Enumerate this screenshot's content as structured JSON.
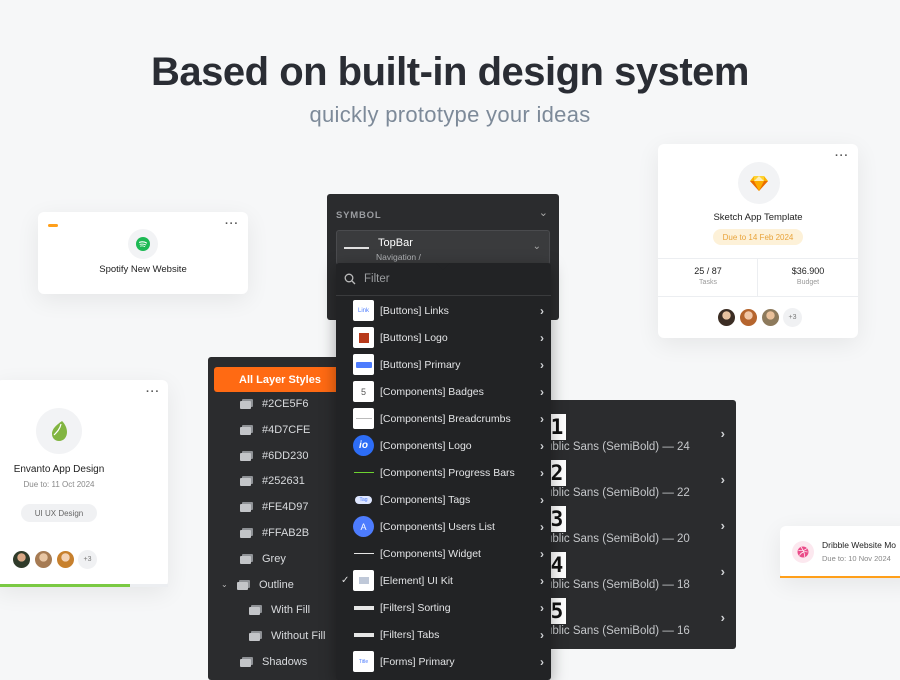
{
  "hero": {
    "title": "Based on built-in design system",
    "subtitle": "quickly prototype your ideas"
  },
  "cards": {
    "spotify": {
      "name": "Spotify New Website",
      "menu": "···"
    },
    "sketch": {
      "name": "Sketch App Template",
      "due": "Due to 14 Feb 2024",
      "tasks_value": "25 / 87",
      "tasks_label": "Tasks",
      "budget_value": "$36.900",
      "budget_label": "Budget",
      "more": "+3",
      "menu": "···"
    },
    "envanto": {
      "name": "Envanto App Design",
      "due": "Due to: 11 Oct 2024",
      "tag": "UI UX Design",
      "more": "+3",
      "progress": 0.78,
      "menu": "···"
    },
    "dribble": {
      "name": "Dribble Website Mo",
      "due": "Due to: 10 Nov 2024"
    }
  },
  "symbol_panel": {
    "title": "SYMBOL",
    "selected_name": "TopBar",
    "selected_path": "Navigation /",
    "filter_placeholder": "Filter",
    "items": [
      {
        "label": "[Buttons] Links",
        "checked": false
      },
      {
        "label": "[Buttons] Logo",
        "checked": false
      },
      {
        "label": "[Buttons] Primary",
        "checked": false
      },
      {
        "label": "[Components] Badges",
        "checked": false
      },
      {
        "label": "[Components] Breadcrumbs",
        "checked": false
      },
      {
        "label": "[Components] Logo",
        "checked": false
      },
      {
        "label": "[Components] Progress Bars",
        "checked": false
      },
      {
        "label": "[Components] Tags",
        "checked": false
      },
      {
        "label": "[Components] Users List",
        "checked": false
      },
      {
        "label": "[Components] Widget",
        "checked": false
      },
      {
        "label": "[Element] UI Kit",
        "checked": true
      },
      {
        "label": "[Filters] Sorting",
        "checked": false
      },
      {
        "label": "[Filters] Tabs",
        "checked": false
      },
      {
        "label": "[Forms] Primary",
        "checked": false
      }
    ],
    "thumbs": {
      "links": "Link",
      "badge": "5",
      "logo_io": "io",
      "tag": "Tag",
      "user": "A",
      "forms": "Title"
    }
  },
  "layer_panel": {
    "header": "All Layer Styles",
    "items": [
      {
        "label": "#2CE5F6",
        "indent": 0,
        "expandable": false
      },
      {
        "label": "#4D7CFE",
        "indent": 0,
        "expandable": false
      },
      {
        "label": "#6DD230",
        "indent": 0,
        "expandable": false
      },
      {
        "label": "#252631",
        "indent": 0,
        "expandable": false
      },
      {
        "label": "#FE4D97",
        "indent": 0,
        "expandable": false
      },
      {
        "label": "#FFAB2B",
        "indent": 0,
        "expandable": false
      },
      {
        "label": "Grey",
        "indent": 0,
        "expandable": false
      },
      {
        "label": "Outline",
        "indent": 0,
        "expandable": true
      },
      {
        "label": "With Fill",
        "indent": 1,
        "expandable": false
      },
      {
        "label": "Without Fill",
        "indent": 1,
        "expandable": false
      },
      {
        "label": "Shadows",
        "indent": 0,
        "expandable": false
      }
    ]
  },
  "typography_panel": {
    "rows": [
      {
        "number": "1",
        "label": "ublic Sans (SemiBold) — 24"
      },
      {
        "number": "2",
        "label": "ublic Sans (SemiBold) — 22"
      },
      {
        "number": "3",
        "label": "ublic Sans (SemiBold) — 20"
      },
      {
        "number": "4",
        "label": "ublic Sans (SemiBold) — 18"
      },
      {
        "number": "5",
        "label": "ublic Sans (SemiBold) — 16"
      }
    ]
  },
  "colors": {
    "accent_orange": "#ff6a13",
    "spotify_green": "#1db954",
    "envato_green": "#82b541",
    "sketch_yellow": "#f7b500",
    "dribbble_pink": "#ea4c89",
    "panel_dark": "#2b2c2e"
  }
}
